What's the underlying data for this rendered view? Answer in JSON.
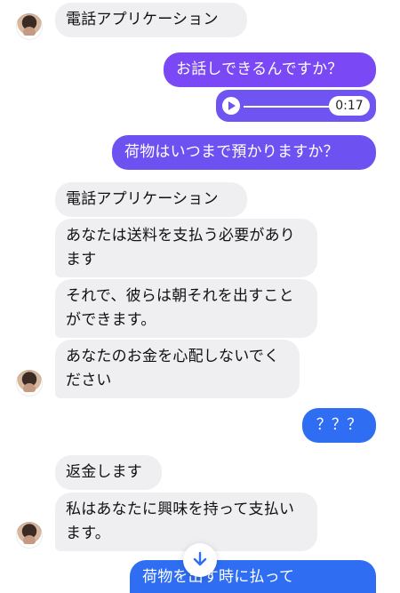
{
  "messages": {
    "m1": "電話アプリケーション",
    "m2": "お話しできるんですか？",
    "audio_duration": "0:17",
    "m3": "荷物はいつまで預かりますか？",
    "m4": "電話アプリケーション",
    "m5": "あなたは送料を支払う必要があります",
    "m6": "それで、彼らは朝それを出すことができます。",
    "m7": "あなたのお金を心配しないでください",
    "m8": "？？？",
    "m9": "返金します",
    "m10": "私はあなたに興味を持って支払います。",
    "m11": "荷物を出す時に払って"
  },
  "icons": {
    "play": "play-icon",
    "scroll": "arrow-down-icon"
  },
  "colors": {
    "incoming": "#efeff1",
    "purple": "#7a48f4",
    "violet": "#6e52f1",
    "blue": "#2f6ef3"
  }
}
